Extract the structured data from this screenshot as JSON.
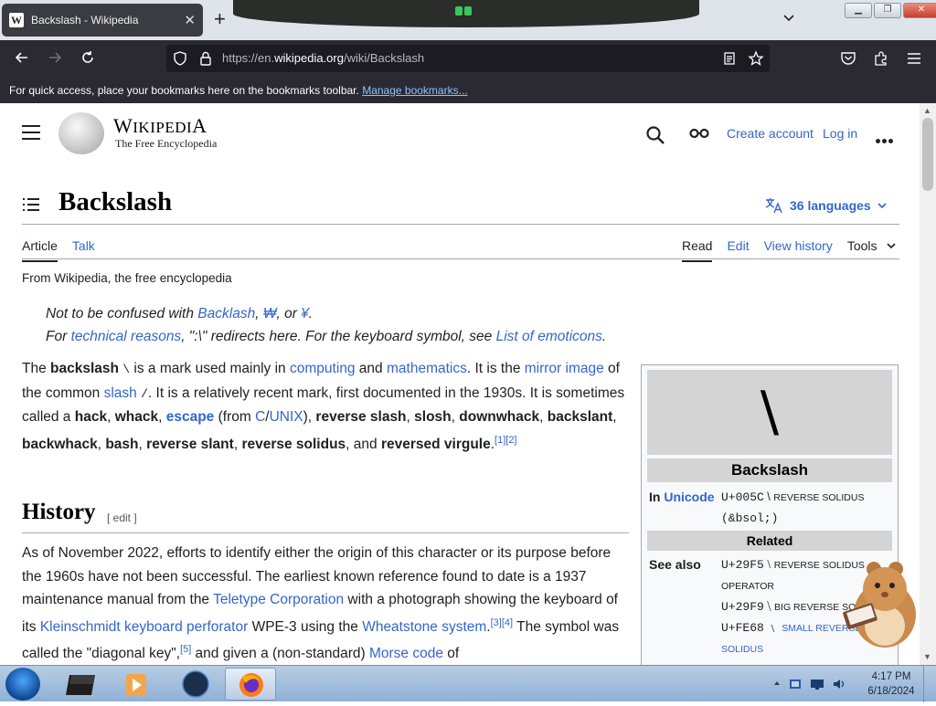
{
  "browser": {
    "tab_title": "Backslash - Wikipedia",
    "tab_favicon": "W",
    "url_prefix": "https://en.",
    "url_domain": "wikipedia.org",
    "url_path": "/wiki/Backslash",
    "bookmarks_notice": "For quick access, place your bookmarks here on the bookmarks toolbar.",
    "bookmarks_link": "Manage bookmarks..."
  },
  "header": {
    "wordmark_first": "W",
    "wordmark_rest": "IKIPEDI",
    "wordmark_last": "A",
    "tagline": "The Free Encyclopedia",
    "create_account": "Create account",
    "log_in": "Log in"
  },
  "article": {
    "title": "Backslash",
    "languages": "36 languages",
    "tab_article": "Article",
    "tab_talk": "Talk",
    "tab_read": "Read",
    "tab_edit": "Edit",
    "tab_history": "View history",
    "tab_tools": "Tools",
    "from": "From Wikipedia, the free encyclopedia",
    "hatnote1": {
      "prefix": "Not to be confused with ",
      "link1": "Backlash",
      "sep1": ", ",
      "link2": "₩",
      "sep2": ", or ",
      "link3": "¥",
      "end": "."
    },
    "hatnote2": {
      "prefix": "For ",
      "link1": "technical reasons",
      "mid": ", \":\\\" redirects here. For the keyboard symbol, see ",
      "link2": "List of emoticons",
      "end": "."
    },
    "history_heading": "History",
    "history_edit": "[ edit ]"
  },
  "infobox": {
    "glyph": "\\",
    "name": "Backslash",
    "in_label": "In ",
    "in_link": "Unicode",
    "unicode_code": "U+005C",
    "unicode_char": "\\",
    "unicode_name": "REVERSE SOLIDUS",
    "unicode_entity": "(&bsol;)",
    "related": "Related",
    "see_also_label": "See also",
    "see_also": [
      {
        "code": "U+29F5",
        "char": "⧵",
        "name": "REVERSE SOLIDUS OPERATOR"
      },
      {
        "code": "U+29F9",
        "char": "⧹",
        "name": "BIG REVERSE SOLIDUS"
      },
      {
        "code": "U+FE68",
        "char": "﹨",
        "name": "SMALL REVERSE SOLIDUS"
      }
    ]
  },
  "taskbar": {
    "time": "4:17 PM",
    "date": "6/18/2024"
  },
  "icons": {
    "colors": {
      "link": "#3366cc",
      "text": "#202122",
      "chrome": "#2b2a33"
    }
  }
}
